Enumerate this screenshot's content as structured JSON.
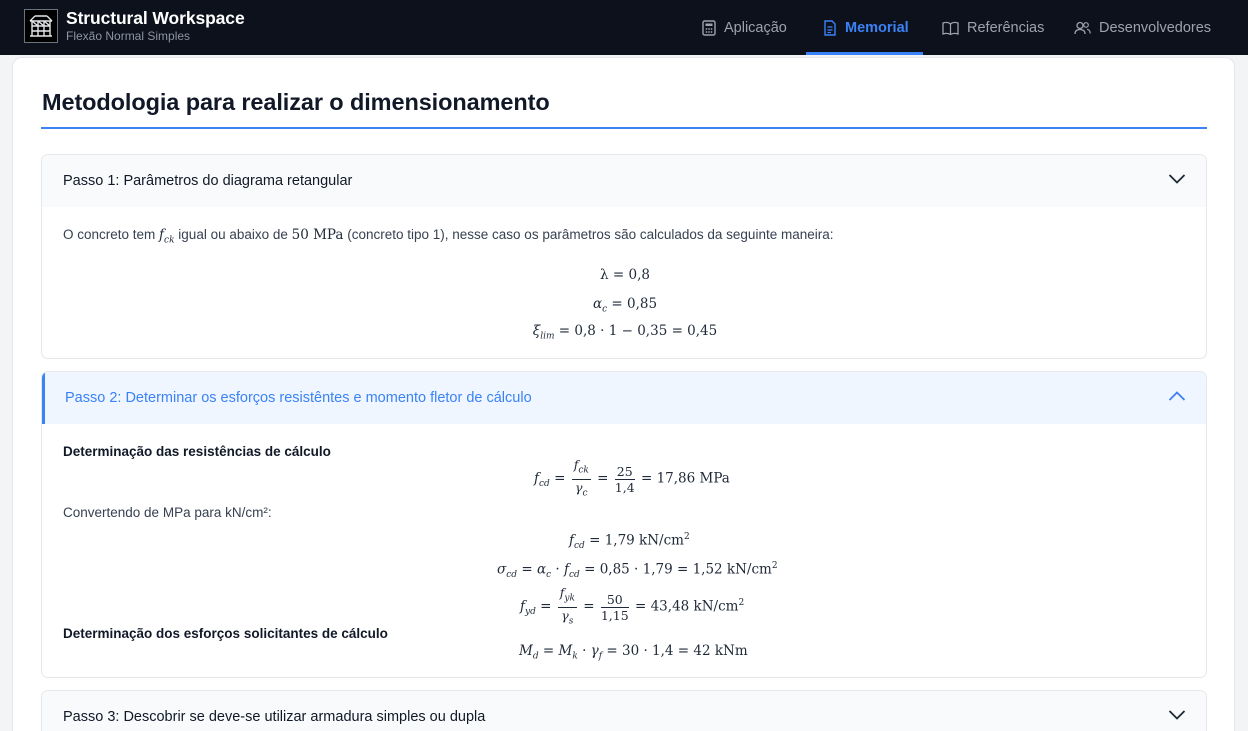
{
  "app": {
    "title": "Structural Workspace",
    "subtitle": "Flexão Normal Simples"
  },
  "nav": [
    {
      "label": "Aplicação",
      "icon": "calculator-icon",
      "active": false
    },
    {
      "label": "Memorial",
      "icon": "document-icon",
      "active": true
    },
    {
      "label": "Referências",
      "icon": "book-icon",
      "active": false
    },
    {
      "label": "Desenvolvedores",
      "icon": "users-icon",
      "active": false
    }
  ],
  "colors": {
    "accent": "#3b82f6",
    "navbar": "#0d111b"
  },
  "page": {
    "title": "Metodologia para realizar o dimensionamento"
  },
  "steps": [
    {
      "title": "Passo 1: Parâmetros do diagrama retangular",
      "expanded": true,
      "intro_a": "O concreto tem ",
      "intro_b": " igual ou abaixo de ",
      "intro_c": " (concreto tipo 1), nesse caso os parâmetros são calculados da seguinte maneira:",
      "fck_symbol": "f",
      "fck_sub": "ck",
      "limit_value": "50 MPa",
      "eq_lambda": "λ = 0,8",
      "eq_alpha_lhs": "α",
      "eq_alpha_sub": "c",
      "eq_alpha_rhs": " = 0,85",
      "eq_xi_lhs": "ξ",
      "eq_xi_sub": "lim",
      "eq_xi_rhs": " = 0,8 · 1 − 0,35 = 0,45"
    },
    {
      "title": "Passo 2: Determinar os esforços resistêntes e momento fletor de cálculo",
      "expanded": true,
      "heading_resist": "Determinação das resistências de cálculo",
      "convert_label": "Convertendo de MPa para kN/cm²:",
      "heading_loads": "Determinação dos esforços solicitantes de cálculo",
      "fcd_frac_den2": "1,4",
      "fcd_frac_num2": "25",
      "fcd_result": " = 17,86 MPa",
      "fcd_kn": " = 1,79 kN/cm",
      "sigma_rhs": " = 0,85 · 1,79 = 1,52 kN/cm",
      "fyd_frac_num2": "50",
      "fyd_frac_den2": "1,15",
      "fyd_result": " = 43,48 kN/cm",
      "md_rhs": " = 30 · 1,4 = 42 kNm"
    },
    {
      "title": "Passo 3: Descobrir se deve-se utilizar armadura simples ou dupla",
      "expanded": false
    }
  ]
}
